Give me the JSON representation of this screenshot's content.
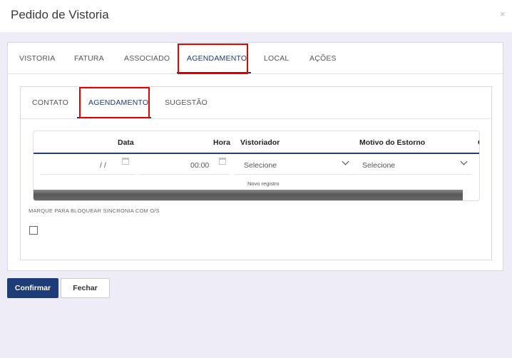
{
  "modal": {
    "title": "Pedido de Vistoria",
    "close_symbol": "×"
  },
  "main_tabs": [
    {
      "label": "VISTORIA",
      "active": false
    },
    {
      "label": "FATURA",
      "active": false
    },
    {
      "label": "ASSOCIADO",
      "active": false
    },
    {
      "label": "AGENDAMENTO",
      "active": true
    },
    {
      "label": "LOCAL",
      "active": false
    },
    {
      "label": "AÇÕES",
      "active": false
    }
  ],
  "sub_tabs": [
    {
      "label": "CONTATO",
      "active": false
    },
    {
      "label": "AGENDAMENTO",
      "active": true
    },
    {
      "label": "SUGESTÃO",
      "active": false
    }
  ],
  "table": {
    "columns": [
      "Data",
      "Hora",
      "Vistoriador",
      "Motivo do Estorno",
      "C"
    ],
    "row": {
      "data": "/ /",
      "hora": "00:00",
      "vistoriador": "Selecione",
      "motivo": "Selecione"
    },
    "new_record_label": "Novo registro"
  },
  "block_sync": {
    "label": "MARQUE PARA BLOQUEAR SINCRONIA COM O/S",
    "checked": false
  },
  "buttons": {
    "confirm": "Confirmar",
    "close": "Fechar"
  },
  "colors": {
    "primary": "#1e3c78",
    "highlight": "#e60000",
    "background": "#eeedf7"
  },
  "icons": [
    "close-icon",
    "calendar-icon",
    "clock-icon",
    "chevron-down-icon"
  ]
}
